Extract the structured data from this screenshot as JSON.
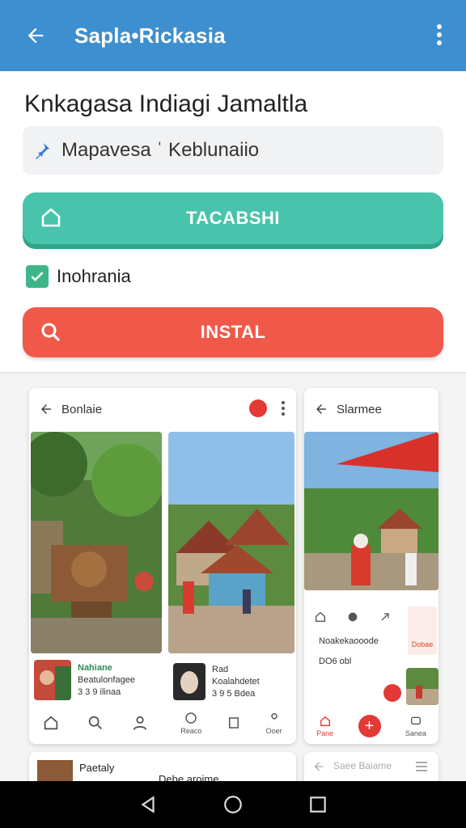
{
  "appbar": {
    "title": "Sapla•Rickasia"
  },
  "main": {
    "heading": "Knkagasa Indiagi Jamaltla",
    "location_value": "Mapavesa ˈ Keblunaiio",
    "primary_button": "TACABSHI",
    "checkbox_label": "Inohrania",
    "install_button": "INSTAL"
  },
  "preview_left": {
    "title": "Bonlaie",
    "item1_line1": "Nahiane",
    "item1_line2": "Beatulonfagee",
    "item1_line3": "3 3 9 ilinaa",
    "item2_line1": "Rad",
    "item2_line2": "Koalahdetet",
    "item2_line3": "3 9 5 Bdea",
    "nav_label1": "Reaco",
    "nav_label2": "Ooer",
    "bottom_line1": "Paetaly",
    "bottom_line2": "Debe aroime"
  },
  "preview_right": {
    "title": "Slarmee",
    "card_title": "Noakekaooode",
    "card_sub": "DO6 obl",
    "card_tag": "Dobae",
    "nav_label1": "Pane",
    "nav_label2": "Sanea",
    "bottom_title": "Saee Baiame"
  },
  "colors": {
    "appbar": "#3d8fcf",
    "primary": "#48c4ac",
    "install": "#f0584a",
    "checkbox": "#3fb68a"
  }
}
